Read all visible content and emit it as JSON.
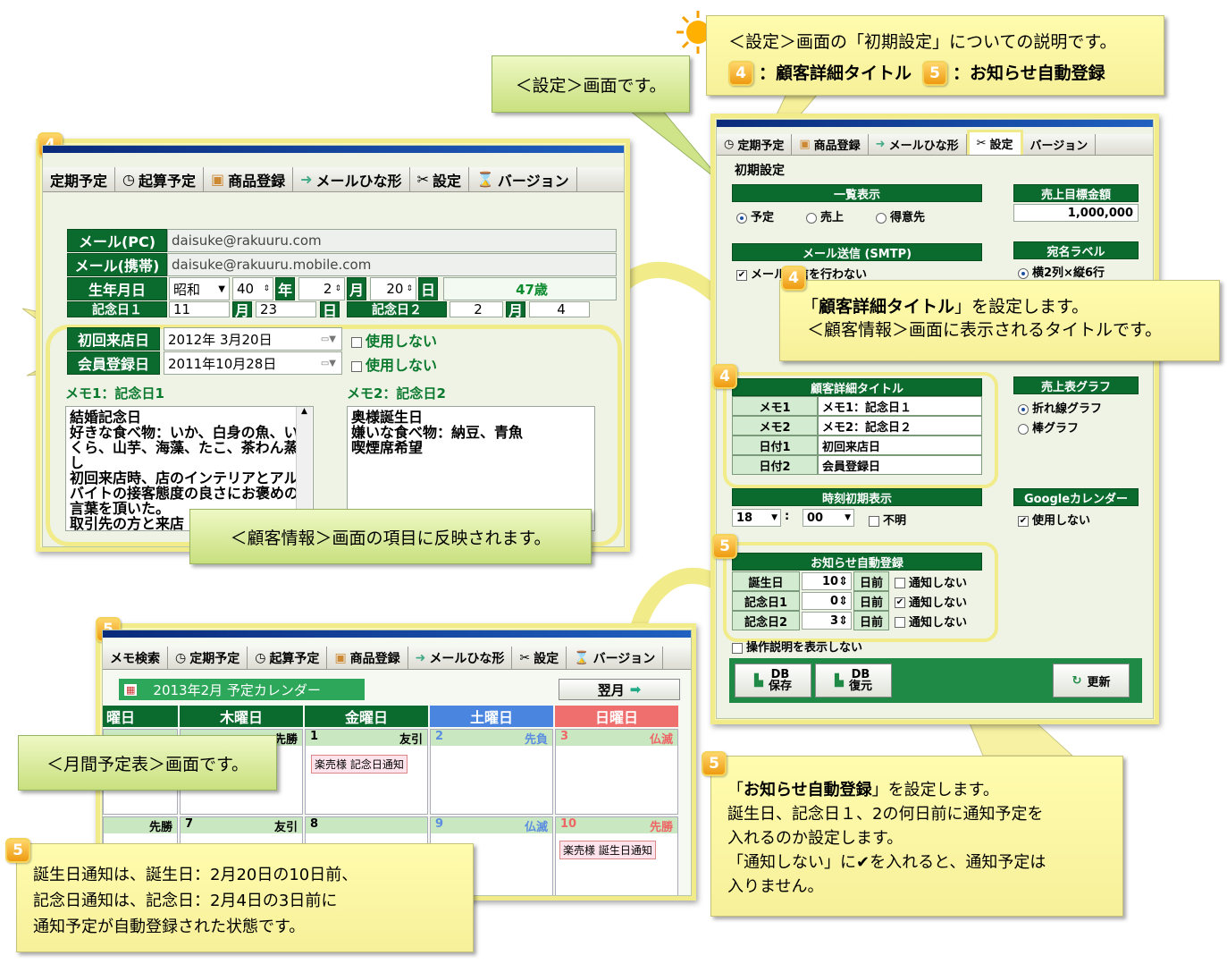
{
  "top_callout": {
    "line1": "＜設定＞画面の「初期設定」についての説明です。",
    "badge4": "4",
    "item4": "：顧客詳細タイトル",
    "badge5": "5",
    "item5": "：お知らせ自動登録"
  },
  "settings_screen_label": "＜設定＞画面です。",
  "customer_screen": {
    "badge": "4",
    "tabs": [
      "定期予定",
      "起算予定",
      "商品登録",
      "メールひな形",
      "設定",
      "バージョン"
    ],
    "fields": {
      "mail_pc_label": "メール(PC)",
      "mail_pc_value": "daisuke@rakuuru.com",
      "mail_mobile_label": "メール(携帯)",
      "mail_mobile_value": "daisuke@rakuuru.mobile.com",
      "birthday_label": "生年月日",
      "era": "昭和",
      "year": "40",
      "year_unit": "年",
      "month": "2",
      "month_unit": "月",
      "day": "20",
      "day_unit": "日",
      "age": "47歳",
      "kinen1_label": "記念日１",
      "kinen1_month": "11",
      "kinen1_day": "23",
      "kinen2_label": "記念日２",
      "kinen2_month": "2",
      "kinen2_day": "4",
      "first_visit_label": "初回来店日",
      "first_visit_value": "2012年  3月20日",
      "member_label": "会員登録日",
      "member_value": "2011年10月28日",
      "unused": "使用しない"
    },
    "memo1_title": "メモ1：記念日1",
    "memo1_text": "結婚記念日\n好きな食べ物：いか、白身の魚、いくら、山芋、海藻、たこ、茶わん蒸し\n初回来店時、店のインテリアとアルバイトの接客態度の良さにお褒めの言葉を頂いた。\n取引先の方と来店",
    "memo2_title": "メモ2：記念日2",
    "memo2_text": "奥様誕生日\n嫌いな食べ物：納豆、青魚\n喫煙席希望",
    "reflect_callout": "＜顧客情報＞画面の項目に反映されます。"
  },
  "settings_panel": {
    "tabs": [
      "定期予定",
      "商品登録",
      "メールひな形",
      "設定",
      "バージョン"
    ],
    "section_title": "初期設定",
    "list_display": {
      "header": "一覧表示",
      "options": [
        "予定",
        "売上",
        "得意先"
      ],
      "selected": "予定"
    },
    "sales_target": {
      "header": "売上目標金額",
      "value": "1,000,000"
    },
    "smtp": {
      "header": "メール送信 (SMTP)",
      "option": "メール送信を行わない",
      "checked": true
    },
    "address_label": {
      "header": "宛名ラベル",
      "option": "横2列×縦6行"
    },
    "detail_title": {
      "header": "顧客詳細タイトル",
      "rows": [
        {
          "key": "メモ1",
          "value": "メモ1：記念日１"
        },
        {
          "key": "メモ2",
          "value": "メモ2：記念日２"
        },
        {
          "key": "日付1",
          "value": "初回来店日"
        },
        {
          "key": "日付2",
          "value": "会員登録日"
        }
      ]
    },
    "sales_graph": {
      "header": "売上表グラフ",
      "options": [
        "折れ線グラフ",
        "棒グラフ"
      ],
      "selected": "折れ線グラフ"
    },
    "time_default": {
      "header": "時刻初期表示",
      "hour": "18",
      "minute": "00",
      "unknown": "不明"
    },
    "google_cal": {
      "header": "Googleカレンダー",
      "option": "使用しない",
      "checked": true
    },
    "notify": {
      "header": "お知らせ自動登録",
      "rows": [
        {
          "key": "誕生日",
          "days": "10",
          "unit": "日前",
          "opt": "通知しない",
          "checked": false
        },
        {
          "key": "記念日1",
          "days": "0",
          "unit": "日前",
          "opt": "通知しない",
          "checked": true
        },
        {
          "key": "記念日2",
          "days": "3",
          "unit": "日前",
          "opt": "通知しない",
          "checked": false
        }
      ]
    },
    "hide_help": "操作説明を表示しない",
    "db_save": "DB\n保存",
    "db_restore": "DB\n復元",
    "update": "更新"
  },
  "callout4": {
    "badge": "4",
    "line1_pre": "「",
    "line1_bold": "顧客詳細タイトル",
    "line1_post": "」を設定します。",
    "line2": "＜顧客情報＞画面に表示されるタイトルです。"
  },
  "callout5": {
    "badge": "5",
    "line1_pre": "「",
    "line1_bold": "お知らせ自動登録",
    "line1_post": "」を設定します。",
    "line2": "誕生日、記念日１、2の何日前に通知予定を",
    "line3": "入れるのか設定します。",
    "line4": "「通知しない」に✔を入れると、通知予定は",
    "line5": "入りません。"
  },
  "calendar": {
    "badge": "5",
    "tabs": [
      "メモ検索",
      "定期予定",
      "起算予定",
      "商品登録",
      "メールひな形",
      "設定",
      "バージョン"
    ],
    "title": "2013年2月  予定カレンダー",
    "next_button": "翌月",
    "weekdays": [
      "曜日",
      "木曜日",
      "金曜日",
      "土曜日",
      "日曜日"
    ],
    "row1": [
      {
        "day": "",
        "rokuyo": ""
      },
      {
        "day": "",
        "rokuyo": "先勝"
      },
      {
        "day": "1",
        "rokuyo": "友引",
        "event": "楽売様  記念日通知"
      },
      {
        "day": "2",
        "rokuyo": "先負"
      },
      {
        "day": "3",
        "rokuyo": "仏滅"
      }
    ],
    "row2": [
      {
        "day": "",
        "rokuyo": "先勝"
      },
      {
        "day": "7",
        "rokuyo": "友引"
      },
      {
        "day": "8",
        "rokuyo": ""
      },
      {
        "day": "9",
        "rokuyo": "仏滅"
      },
      {
        "day": "10",
        "rokuyo": "先勝",
        "event": "楽売様  誕生日通知"
      }
    ],
    "monthly_label": "＜月間予定表＞画面です。"
  },
  "bottom_callout": {
    "badge": "5",
    "line1": "誕生日通知は、誕生日：2月20日の10日前、",
    "line2": "記念日通知は、記念日：2月4日の3日前に",
    "line3": "通知予定が自動登録された状態です。"
  }
}
